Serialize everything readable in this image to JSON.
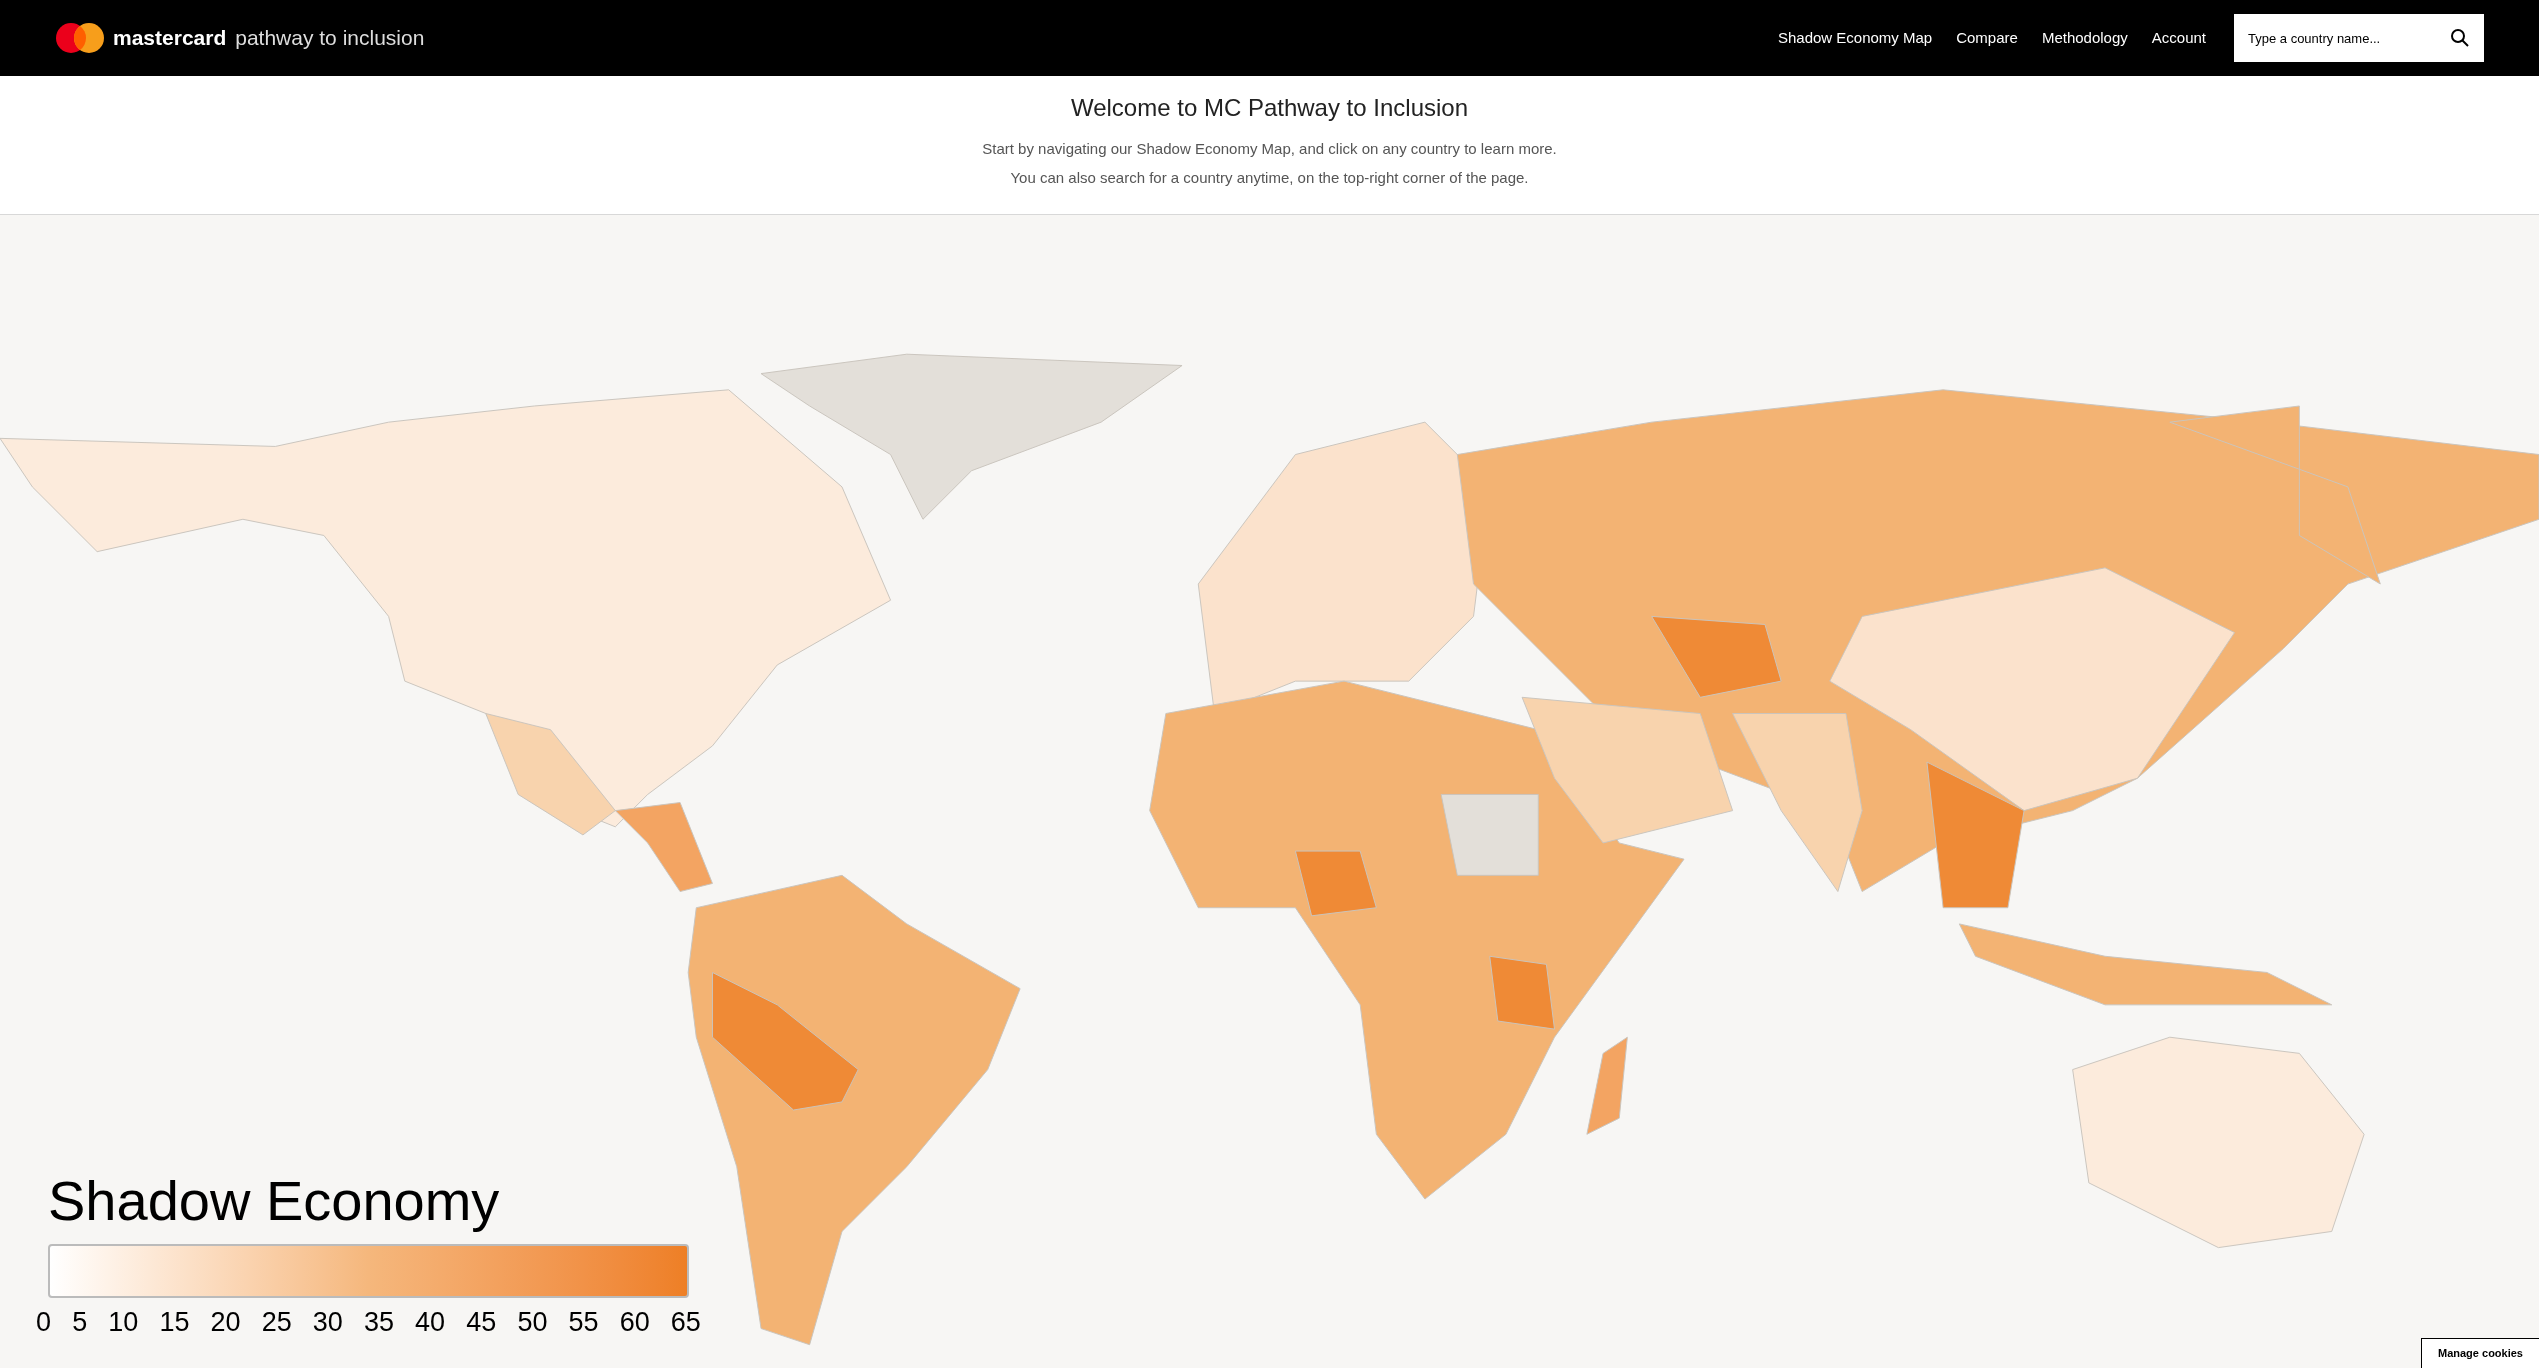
{
  "header": {
    "brand": "mastercard",
    "product": "pathway to inclusion",
    "nav": [
      "Shadow Economy Map",
      "Compare",
      "Methodology",
      "Account"
    ],
    "search": {
      "placeholder": "Type a country name..."
    }
  },
  "intro": {
    "title": "Welcome to MC Pathway to Inclusion",
    "lines": [
      "Start by navigating our Shadow Economy Map, and click on any country to learn more.",
      "You can also search for a country anytime, on the top-right corner of the page."
    ]
  },
  "legend": {
    "title": "Shadow Economy",
    "ticks": [
      "0",
      "5",
      "10",
      "15",
      "20",
      "25",
      "30",
      "35",
      "40",
      "45",
      "50",
      "55",
      "60",
      "65"
    ]
  },
  "cookies_button": "Manage cookies"
}
